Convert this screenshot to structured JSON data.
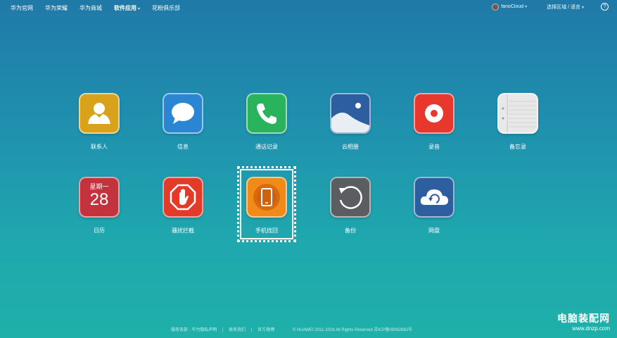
{
  "nav": {
    "items": [
      {
        "label": "华为官网"
      },
      {
        "label": "华为荣耀"
      },
      {
        "label": "华为商城"
      },
      {
        "label": "软件应用",
        "has_caret": true
      },
      {
        "label": "花粉俱乐部"
      }
    ],
    "username": "fanoCloud",
    "region": "选择区域 / 语言",
    "help": "?"
  },
  "apps": [
    {
      "label": "联系人",
      "icon": "contacts-icon",
      "color": "#d8a21a"
    },
    {
      "label": "信息",
      "icon": "messages-icon",
      "color": "#2a85d3"
    },
    {
      "label": "通话记录",
      "icon": "phone-icon",
      "color": "#28b35c"
    },
    {
      "label": "云相册",
      "icon": "gallery-icon",
      "color": "#2d5fa0"
    },
    {
      "label": "录音",
      "icon": "recorder-icon",
      "color": "#e8372c"
    },
    {
      "label": "备忘录",
      "icon": "notepad-icon",
      "color": "#e8e8e8"
    },
    {
      "label": "日历",
      "icon": "calendar-icon",
      "color": "#c2333e",
      "weekday": "星期一",
      "day": "28"
    },
    {
      "label": "骚扰拦截",
      "icon": "block-hand-icon",
      "color": "#e33a2a"
    },
    {
      "label": "手机找回",
      "icon": "find-phone-icon",
      "color": "#f08a18"
    },
    {
      "label": "备份",
      "icon": "backup-icon",
      "color": "#5a5d62"
    },
    {
      "label": "网盘",
      "icon": "cloud-drive-icon",
      "color": "#2d5fa0"
    }
  ],
  "footer": {
    "links": [
      "服务条款 - 华为隐私声明",
      "|",
      "联系我们",
      "|",
      "官方微博"
    ],
    "copyright": "© HUAWEI 2011-2016 All Rights Reserved 苏ICP备09062682号"
  },
  "watermark": {
    "line1": "电脑装配网",
    "line2": "www.dnzp.com"
  }
}
